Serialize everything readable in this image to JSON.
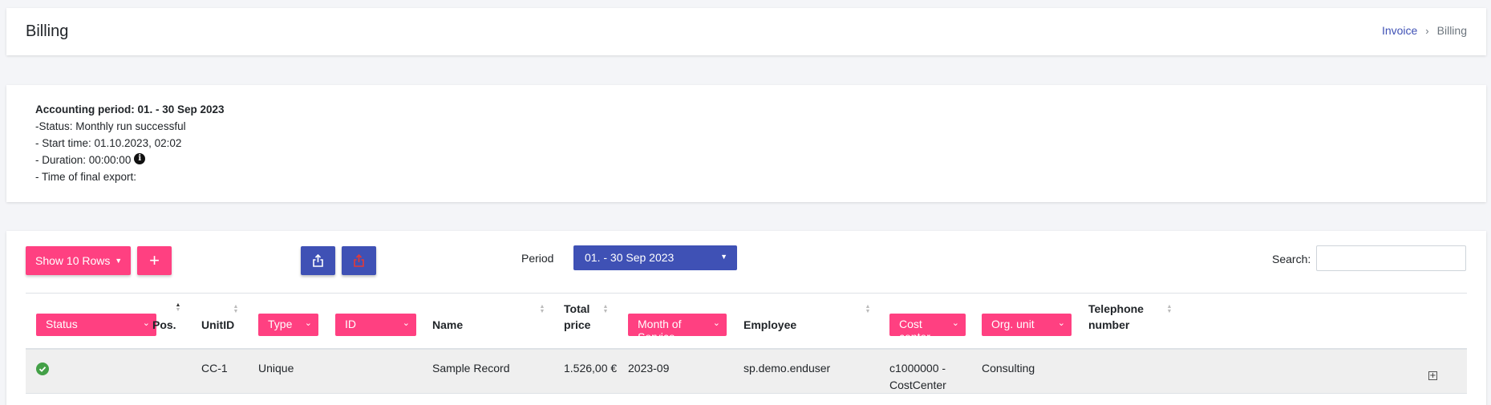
{
  "header": {
    "title": "Billing",
    "breadcrumb": {
      "parent": "Invoice",
      "separator": "›",
      "current": "Billing"
    }
  },
  "info": {
    "period_line": "Accounting period: 01. - 30 Sep 2023",
    "status_line": "-Status: Monthly run successful",
    "start_line": "- Start time: 01.10.2023, 02:02",
    "duration_line": "- Duration: 00:00:00",
    "export_line": "- Time of final export:"
  },
  "toolbar": {
    "show_rows_label": "Show 10 Rows",
    "add_label": "+",
    "period_label": "Period",
    "period_value": "01. - 30 Sep 2023",
    "search_label": "Search:",
    "search_value": ""
  },
  "table": {
    "columns": {
      "status": "Status",
      "pos": "Pos.",
      "unitid": "UnitID",
      "type": "Type",
      "id": "ID",
      "name": "Name",
      "total_price_1": "Total",
      "total_price_2": "price",
      "month_of_service": "Month of Service",
      "employee": "Employee",
      "cost_center": "Cost center",
      "org_unit": "Org. unit",
      "telephone_1": "Telephone",
      "telephone_2": "number"
    },
    "rows": [
      {
        "status": "success",
        "pos": "",
        "unitid": "CC-1",
        "type": "Unique",
        "id": "",
        "name": "Sample Record",
        "total_price": "1.526,00 €",
        "month_of_service": "2023-09",
        "employee": "sp.demo.enduser",
        "cost_center_1": "c1000000 -",
        "cost_center_2": "CostCenter",
        "org_unit": "Consulting",
        "telephone": ""
      }
    ]
  },
  "colors": {
    "accent_pink": "#ff4081",
    "primary_blue": "#3f51b5",
    "success_green": "#43a047"
  }
}
